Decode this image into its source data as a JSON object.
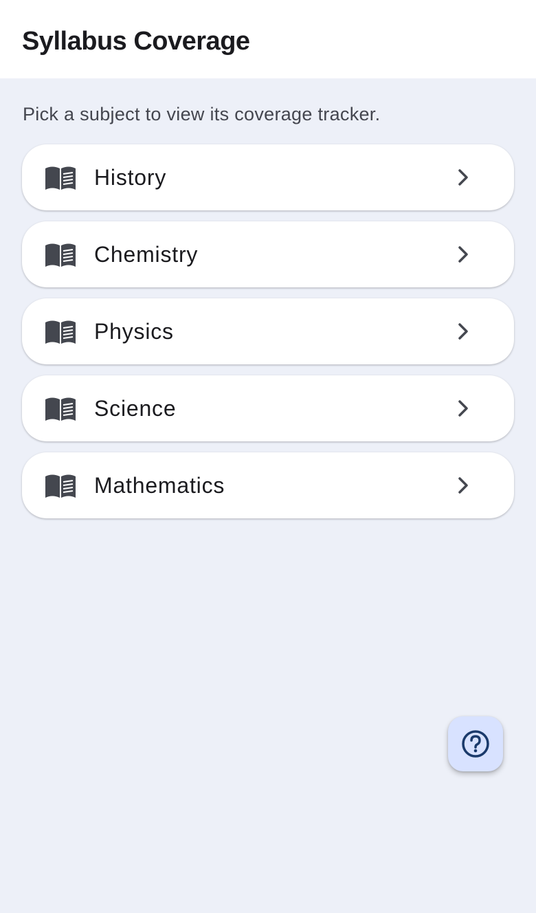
{
  "app_bar": {
    "title": "Syllabus Coverage"
  },
  "subtitle": "Pick a subject to view its coverage tracker.",
  "subjects": [
    {
      "label": "History",
      "icon": "book-icon",
      "trailing_icon": "chevron-right-icon"
    },
    {
      "label": "Chemistry",
      "icon": "book-icon",
      "trailing_icon": "chevron-right-icon"
    },
    {
      "label": "Physics",
      "icon": "book-icon",
      "trailing_icon": "chevron-right-icon"
    },
    {
      "label": "Science",
      "icon": "book-icon",
      "trailing_icon": "chevron-right-icon"
    },
    {
      "label": "Mathematics",
      "icon": "book-icon",
      "trailing_icon": "chevron-right-icon"
    }
  ],
  "fab": {
    "icon": "help-circle-icon"
  },
  "colors": {
    "background": "#EDF0F8",
    "surface": "#FFFFFF",
    "text_primary": "#1B1B1F",
    "text_secondary": "#44464F",
    "icon": "#44474F",
    "fab_container": "#D8E2FF",
    "fab_icon": "#1A3A6B"
  }
}
